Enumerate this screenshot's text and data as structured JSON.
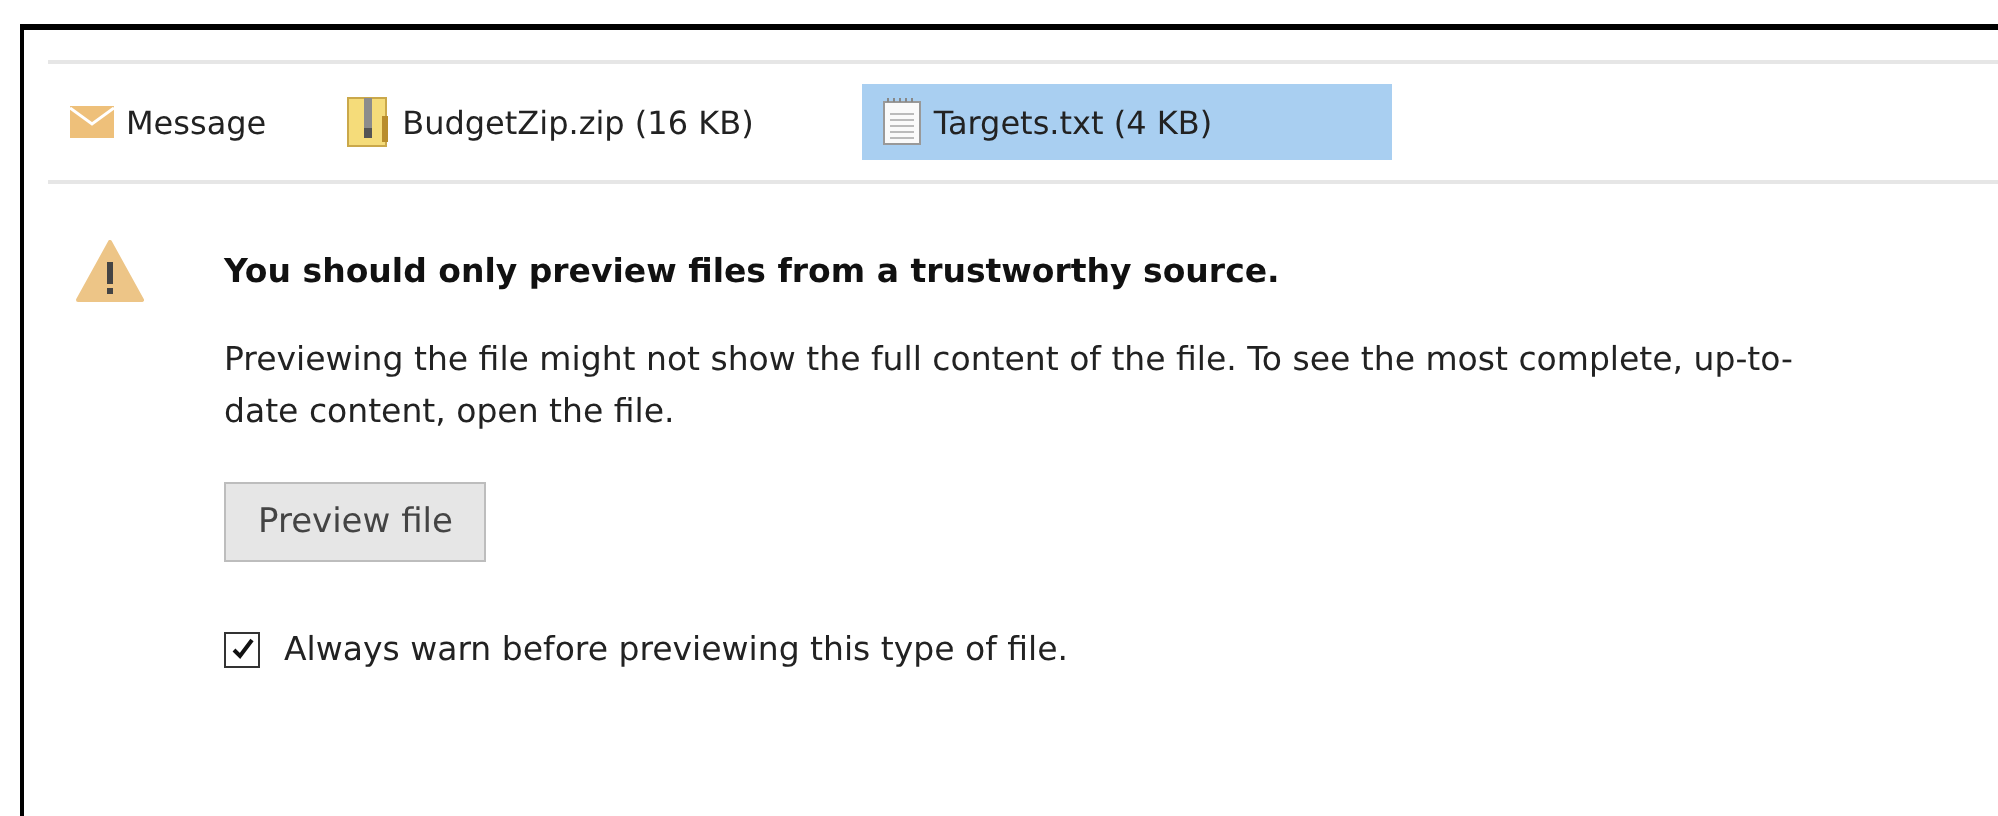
{
  "attachments": [
    {
      "kind": "message",
      "label": "Message",
      "selected": false
    },
    {
      "kind": "zip",
      "label": "BudgetZip.zip (16 KB)",
      "selected": false
    },
    {
      "kind": "text",
      "label": "Targets.txt (4 KB)",
      "selected": true
    }
  ],
  "warning": {
    "title": "You should only preview files from a trustworthy source.",
    "message": "Previewing the file might not show the full content of the file. To see the most complete, up-to-date content, open the file.",
    "button": "Preview file",
    "checkbox": {
      "label": "Always warn before previewing this type of file.",
      "checked": true
    }
  }
}
